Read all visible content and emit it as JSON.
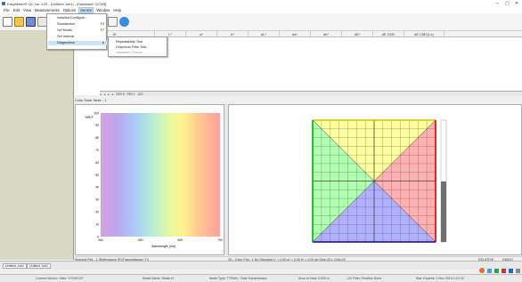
{
  "app": {
    "title": "EasyMatch® QC ver 4.93 - [Untitled Job1] - [Database: QCDB]",
    "controls": {
      "minimize": "–",
      "maximize": "▢",
      "close": "✕"
    }
  },
  "menu": {
    "items": [
      "File",
      "Edit",
      "View",
      "Measurements",
      "Options",
      "Sensor",
      "Window",
      "Help"
    ],
    "active": "Sensor"
  },
  "sensor_menu": {
    "items": [
      {
        "label": "Initialize/Configure...",
        "shortcut": ""
      },
      {
        "label": "Standardize",
        "shortcut": "F4"
      },
      {
        "label": "Set Model",
        "shortcut": "F7"
      },
      {
        "label": "Set Interval",
        "shortcut": ""
      },
      {
        "label": "Diagnostics",
        "shortcut": ""
      }
    ],
    "highlighted": "Diagnostics"
  },
  "diagnostics_submenu": {
    "items": [
      {
        "label": "Repeatability Test",
        "enabled": true
      },
      {
        "label": "Didymium Filter Test",
        "enabled": true
      },
      {
        "label": "Hardware Checks",
        "enabled": false
      }
    ]
  },
  "grid": {
    "columns": [
      "ID",
      "L*",
      "a*",
      "b*",
      "dL*",
      "da*",
      "db*",
      "dE*",
      "dE CMC",
      "dE CMC(l:c)"
    ]
  },
  "sheet_tabs": [
    "DEV 5",
    "PEX 1",
    "A70"
  ],
  "color_data_label": "Color Data Table - 1",
  "spectral_chart": {
    "ylabel": "%R/T",
    "xlabel": "Wavelength (nm)"
  },
  "chart_data": {
    "type": "line",
    "title": "",
    "xlabel": "Wavelength (nm)",
    "ylabel": "%R/T",
    "xlim": [
      400,
      700
    ],
    "ylim": [
      0,
      100
    ],
    "x_ticks": [
      400,
      500,
      600,
      700
    ],
    "y_ticks": [
      0,
      10,
      20,
      30,
      40,
      50,
      60,
      70,
      80,
      90,
      100
    ],
    "series": [],
    "grid": false,
    "background": "visible spectrum gradient"
  },
  "cielab_plot": {
    "quadrant_colors": {
      "top": "#ffffa0",
      "right": "#ffb0b0",
      "bottom": "#b0b0ff",
      "left": "#b0ffb0"
    },
    "border_colors": {
      "top": "#c8c800",
      "right": "#d00000",
      "bottom": "#0000d0",
      "left": "#00b000"
    },
    "axis_color": "#000000"
  },
  "status_strip": {
    "left": "Spectral Plot - 1 (Reflectance (R)/Transmittance (T))",
    "middle": "2D - Color Plot - 1 No Standard  L* = 0.00  a* = 0.00  b* = 0.00    ab Grid=20  L Grid=20",
    "right1": "RELATIVE",
    "right2": "D65/10"
  },
  "doc_tabs": [
    "Untitled Job1",
    "Untitled Job2"
  ],
  "status_bar": {
    "sensor": "Current Sensor: Vista \"VTG0C19\"",
    "mode_name": "Mode Name: Mode #1",
    "mode_type": "Mode Type: TTRAN - Total Transmission",
    "area_of_view": "Area of View: 0.000 in",
    "uv_filter": "UV Filter: Position None",
    "stat_expires": "Stat. Expires: 3 Nov 2018 2:12:33"
  }
}
